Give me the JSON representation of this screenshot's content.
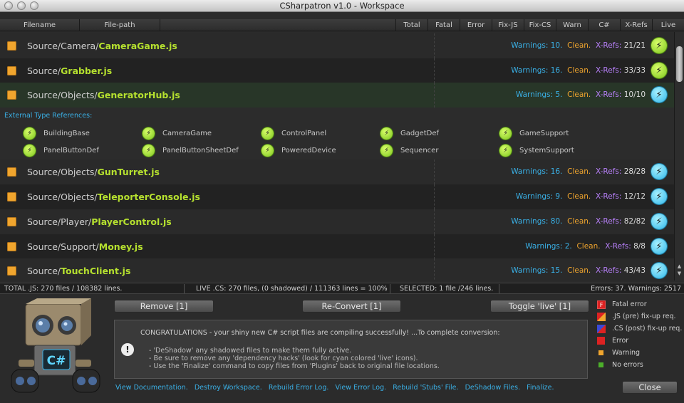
{
  "window": {
    "title": "CSharpatron v1.0 - Workspace"
  },
  "columns": {
    "filename": "Filename",
    "filepath": "File-path",
    "total": "Total",
    "fatal": "Fatal",
    "error": "Error",
    "fixjs": "Fix-JS",
    "fixcs": "Fix-CS",
    "warn": "Warn",
    "cs": "C#",
    "xrefs": "X-Refs",
    "live": "Live"
  },
  "rows": [
    {
      "dir": "Source/Camera/",
      "name": "CameraGame.js",
      "warn_label": "Warnings:",
      "warnings": "10.",
      "clean": "Clean.",
      "xref_label": "X-Refs:",
      "xrefs": "21/21",
      "status": "green"
    },
    {
      "dir": "Source/",
      "name": "Grabber.js",
      "warn_label": "Warnings:",
      "warnings": "16.",
      "clean": "Clean.",
      "xref_label": "X-Refs:",
      "xrefs": "33/33",
      "status": "green"
    },
    {
      "dir": "Source/Objects/",
      "name": "GeneratorHub.js",
      "warn_label": "Warnings:",
      "warnings": "5.",
      "clean": "Clean.",
      "xref_label": "X-Refs:",
      "xrefs": "10/10",
      "status": "cyan"
    },
    {
      "dir": "Source/Objects/",
      "name": "GunTurret.js",
      "warn_label": "Warnings:",
      "warnings": "16.",
      "clean": "Clean.",
      "xref_label": "X-Refs:",
      "xrefs": "28/28",
      "status": "cyan"
    },
    {
      "dir": "Source/Objects/",
      "name": "TeleporterConsole.js",
      "warn_label": "Warnings:",
      "warnings": "9.",
      "clean": "Clean.",
      "xref_label": "X-Refs:",
      "xrefs": "12/12",
      "status": "cyan"
    },
    {
      "dir": "Source/Player/",
      "name": "PlayerControl.js",
      "warn_label": "Warnings:",
      "warnings": "80.",
      "clean": "Clean.",
      "xref_label": "X-Refs:",
      "xrefs": "82/82",
      "status": "cyan"
    },
    {
      "dir": "Source/Support/",
      "name": "Money.js",
      "warn_label": "Warnings:",
      "warnings": "2.",
      "clean": "Clean.",
      "xref_label": "X-Refs:",
      "xrefs": "8/8",
      "status": "cyan"
    },
    {
      "dir": "Source/",
      "name": "TouchClient.js",
      "warn_label": "Warnings:",
      "warnings": "15.",
      "clean": "Clean.",
      "xref_label": "X-Refs:",
      "xrefs": "43/43",
      "status": "cyan"
    }
  ],
  "external_refs": {
    "heading": "External Type References:",
    "items": [
      "BuildingBase",
      "CameraGame",
      "ControlPanel",
      "GadgetDef",
      "GameSupport",
      "PanelButtonDef",
      "PanelButtonSheetDef",
      "PoweredDevice",
      "Sequencer",
      "SystemSupport"
    ]
  },
  "status": {
    "total_js": "TOTAL .JS: 270 files / 108382 lines.",
    "live_cs": "LIVE .CS: 270 files, (0 shadowed) / 111363 lines = 100%",
    "selected": "SELECTED: 1 file /246 lines.",
    "errors": "Errors: 37. Warnings: 2517"
  },
  "buttons": {
    "remove": "Remove [1]",
    "reconvert": "Re-Convert [1]",
    "toggle_live": "Toggle 'live' [1]",
    "close": "Close"
  },
  "message": {
    "main": "CONGRATULATIONS - your shiny new C# script files are compiling successfully! ...To complete conversion:",
    "lines": [
      "- 'DeShadow' any shadowed files to make them fully active.",
      "- Be sure to remove any 'dependency hacks' (look for cyan colored 'live' icons).",
      "- Use the 'Finalize' command to copy files from 'Plugins' back to original file locations."
    ]
  },
  "links": [
    "View Documentation.",
    "Destroy Workspace.",
    "Rebuild Error Log.",
    "View Error Log.",
    "Rebuild 'Stubs' File.",
    "DeShadow Files.",
    "Finalize."
  ],
  "legend": [
    "Fatal error",
    ".JS (pre) fix-up req.",
    ".CS (post) fix-up req.",
    "Error",
    "Warning",
    "No errors"
  ],
  "robot": {
    "chest_label": "C#"
  },
  "colors": {
    "accent_blue": "#3ab0e6",
    "accent_orange": "#f0a52e",
    "accent_purple": "#b67ff7",
    "file_green": "#b6e12f"
  }
}
